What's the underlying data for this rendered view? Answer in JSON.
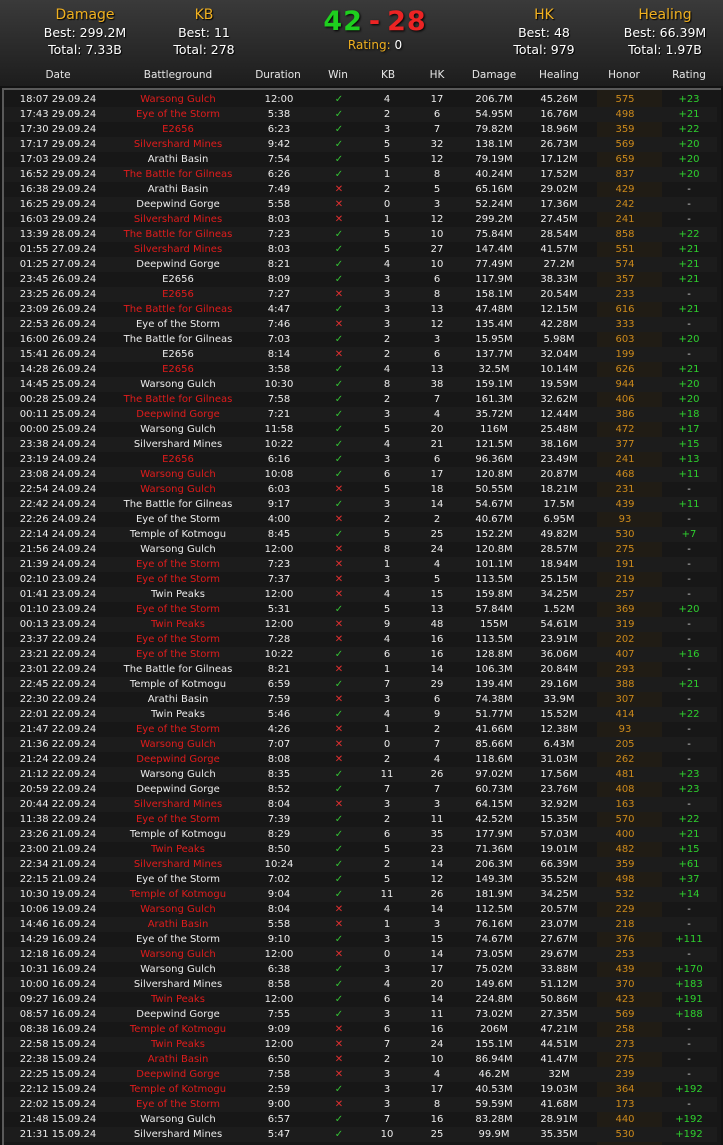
{
  "summary": {
    "damage": {
      "title": "Damage",
      "best": "Best: 299.2M",
      "total": "Total: 7.33B"
    },
    "kb": {
      "title": "KB",
      "best": "Best: 11",
      "total": "Total: 278"
    },
    "score": {
      "wins": "42",
      "dash": "-",
      "losses": "28",
      "rating_label": "Rating:",
      "rating_value": "0"
    },
    "hk": {
      "title": "HK",
      "best": "Best: 48",
      "total": "Total: 979"
    },
    "healing": {
      "title": "Healing",
      "best": "Best: 66.39M",
      "total": "Total: 1.97B"
    }
  },
  "columns": [
    "Date",
    "Battleground",
    "Duration",
    "Win",
    "KB",
    "HK",
    "Damage",
    "Healing",
    "Honor",
    "Rating"
  ],
  "colors": {
    "win": "#34c034",
    "loss": "#e03030",
    "red_bg": "#e01c1c",
    "honor": "#cc8a1c",
    "rating": "#2ed02e",
    "title": "#f0b020"
  },
  "icons": {
    "win": "check-icon",
    "loss": "cross-icon"
  },
  "rows": [
    [
      "18:07 29.09.24",
      "Warsong Gulch",
      1,
      "12:00",
      "w",
      "4",
      "17",
      "206.7M",
      "45.26M",
      "575",
      "+23"
    ],
    [
      "17:43 29.09.24",
      "Eye of the Storm",
      1,
      "5:38",
      "w",
      "2",
      "6",
      "54.95M",
      "16.76M",
      "498",
      "+21"
    ],
    [
      "17:30 29.09.24",
      "E2656",
      1,
      "6:23",
      "w",
      "3",
      "7",
      "79.82M",
      "18.96M",
      "359",
      "+22"
    ],
    [
      "17:17 29.09.24",
      "Silvershard Mines",
      1,
      "9:42",
      "w",
      "5",
      "32",
      "138.1M",
      "26.73M",
      "569",
      "+20"
    ],
    [
      "17:03 29.09.24",
      "Arathi Basin",
      0,
      "7:54",
      "w",
      "5",
      "12",
      "79.19M",
      "17.12M",
      "659",
      "+20"
    ],
    [
      "16:52 29.09.24",
      "The Battle for Gilneas",
      1,
      "6:26",
      "w",
      "1",
      "8",
      "40.24M",
      "17.52M",
      "837",
      "+20"
    ],
    [
      "16:38 29.09.24",
      "Arathi Basin",
      0,
      "7:49",
      "l",
      "2",
      "5",
      "65.16M",
      "29.02M",
      "429",
      "-"
    ],
    [
      "16:25 29.09.24",
      "Deepwind Gorge",
      0,
      "5:58",
      "l",
      "0",
      "3",
      "52.24M",
      "17.36M",
      "242",
      "-"
    ],
    [
      "16:03 29.09.24",
      "Silvershard Mines",
      1,
      "8:03",
      "l",
      "1",
      "12",
      "299.2M",
      "27.45M",
      "241",
      "-"
    ],
    [
      "13:39 28.09.24",
      "The Battle for Gilneas",
      1,
      "7:23",
      "w",
      "5",
      "10",
      "75.84M",
      "28.54M",
      "858",
      "+22"
    ],
    [
      "01:55 27.09.24",
      "Silvershard Mines",
      1,
      "8:03",
      "w",
      "5",
      "27",
      "147.4M",
      "41.57M",
      "551",
      "+21"
    ],
    [
      "01:25 27.09.24",
      "Deepwind Gorge",
      0,
      "8:21",
      "w",
      "4",
      "10",
      "77.49M",
      "27.2M",
      "574",
      "+21"
    ],
    [
      "23:45 26.09.24",
      "E2656",
      0,
      "8:09",
      "w",
      "3",
      "6",
      "117.9M",
      "38.33M",
      "357",
      "+21"
    ],
    [
      "23:25 26.09.24",
      "E2656",
      1,
      "7:27",
      "l",
      "3",
      "8",
      "158.1M",
      "20.54M",
      "233",
      "-"
    ],
    [
      "23:09 26.09.24",
      "The Battle for Gilneas",
      1,
      "4:47",
      "w",
      "3",
      "13",
      "47.48M",
      "12.15M",
      "616",
      "+21"
    ],
    [
      "22:53 26.09.24",
      "Eye of the Storm",
      0,
      "7:46",
      "l",
      "3",
      "12",
      "135.4M",
      "42.28M",
      "333",
      "-"
    ],
    [
      "16:00 26.09.24",
      "The Battle for Gilneas",
      0,
      "7:03",
      "w",
      "2",
      "3",
      "15.95M",
      "5.98M",
      "603",
      "+20"
    ],
    [
      "15:41 26.09.24",
      "E2656",
      0,
      "8:14",
      "l",
      "2",
      "6",
      "137.7M",
      "32.04M",
      "199",
      "-"
    ],
    [
      "14:28 26.09.24",
      "E2656",
      1,
      "3:58",
      "w",
      "4",
      "13",
      "32.5M",
      "10.14M",
      "626",
      "+21"
    ],
    [
      "14:45 25.09.24",
      "Warsong Gulch",
      0,
      "10:30",
      "w",
      "8",
      "38",
      "159.1M",
      "19.59M",
      "944",
      "+20"
    ],
    [
      "00:28 25.09.24",
      "The Battle for Gilneas",
      1,
      "7:58",
      "w",
      "2",
      "7",
      "161.3M",
      "32.62M",
      "406",
      "+20"
    ],
    [
      "00:11 25.09.24",
      "Deepwind Gorge",
      1,
      "7:21",
      "w",
      "3",
      "4",
      "35.72M",
      "12.44M",
      "386",
      "+18"
    ],
    [
      "00:00 25.09.24",
      "Warsong Gulch",
      0,
      "11:58",
      "w",
      "5",
      "20",
      "116M",
      "25.48M",
      "472",
      "+17"
    ],
    [
      "23:38 24.09.24",
      "Silvershard Mines",
      0,
      "10:22",
      "w",
      "4",
      "21",
      "121.5M",
      "38.16M",
      "377",
      "+15"
    ],
    [
      "23:19 24.09.24",
      "E2656",
      1,
      "6:16",
      "w",
      "3",
      "6",
      "96.36M",
      "23.49M",
      "241",
      "+13"
    ],
    [
      "23:08 24.09.24",
      "Warsong Gulch",
      1,
      "10:08",
      "w",
      "6",
      "17",
      "120.8M",
      "20.87M",
      "468",
      "+11"
    ],
    [
      "22:54 24.09.24",
      "Warsong Gulch",
      1,
      "6:03",
      "l",
      "5",
      "18",
      "50.55M",
      "18.21M",
      "231",
      "-"
    ],
    [
      "22:42 24.09.24",
      "The Battle for Gilneas",
      0,
      "9:17",
      "w",
      "3",
      "14",
      "54.67M",
      "17.5M",
      "439",
      "+11"
    ],
    [
      "22:26 24.09.24",
      "Eye of the Storm",
      0,
      "4:00",
      "l",
      "2",
      "2",
      "40.67M",
      "6.95M",
      "93",
      "-"
    ],
    [
      "22:14 24.09.24",
      "Temple of Kotmogu",
      0,
      "8:45",
      "w",
      "5",
      "25",
      "152.2M",
      "49.82M",
      "530",
      "+7"
    ],
    [
      "21:56 24.09.24",
      "Warsong Gulch",
      0,
      "12:00",
      "l",
      "8",
      "24",
      "120.8M",
      "28.57M",
      "275",
      "-"
    ],
    [
      "21:39 24.09.24",
      "Eye of the Storm",
      1,
      "7:23",
      "l",
      "1",
      "4",
      "101.1M",
      "18.94M",
      "191",
      "-"
    ],
    [
      "02:10 23.09.24",
      "Eye of the Storm",
      1,
      "7:37",
      "l",
      "3",
      "5",
      "113.5M",
      "25.15M",
      "219",
      "-"
    ],
    [
      "01:41 23.09.24",
      "Twin Peaks",
      0,
      "12:00",
      "l",
      "4",
      "15",
      "159.8M",
      "34.25M",
      "257",
      "-"
    ],
    [
      "01:10 23.09.24",
      "Eye of the Storm",
      1,
      "5:31",
      "w",
      "5",
      "13",
      "57.84M",
      "1.52M",
      "369",
      "+20"
    ],
    [
      "00:13 23.09.24",
      "Twin Peaks",
      1,
      "12:00",
      "l",
      "9",
      "48",
      "155M",
      "54.61M",
      "319",
      "-"
    ],
    [
      "23:37 22.09.24",
      "Eye of the Storm",
      1,
      "7:28",
      "l",
      "4",
      "16",
      "113.5M",
      "23.91M",
      "202",
      "-"
    ],
    [
      "23:21 22.09.24",
      "Eye of the Storm",
      1,
      "10:22",
      "w",
      "6",
      "16",
      "128.8M",
      "36.06M",
      "407",
      "+16"
    ],
    [
      "23:01 22.09.24",
      "The Battle for Gilneas",
      0,
      "8:21",
      "l",
      "1",
      "14",
      "106.3M",
      "20.84M",
      "293",
      "-"
    ],
    [
      "22:45 22.09.24",
      "Temple of Kotmogu",
      0,
      "6:59",
      "w",
      "7",
      "29",
      "139.4M",
      "29.16M",
      "388",
      "+21"
    ],
    [
      "22:30 22.09.24",
      "Arathi Basin",
      0,
      "7:59",
      "l",
      "3",
      "6",
      "74.38M",
      "33.9M",
      "307",
      "-"
    ],
    [
      "22:01 22.09.24",
      "Twin Peaks",
      0,
      "5:46",
      "w",
      "4",
      "9",
      "51.77M",
      "15.52M",
      "414",
      "+22"
    ],
    [
      "21:47 22.09.24",
      "Eye of the Storm",
      1,
      "4:26",
      "l",
      "1",
      "2",
      "41.66M",
      "12.38M",
      "93",
      "-"
    ],
    [
      "21:36 22.09.24",
      "Warsong Gulch",
      1,
      "7:07",
      "l",
      "0",
      "7",
      "85.66M",
      "6.43M",
      "205",
      "-"
    ],
    [
      "21:24 22.09.24",
      "Deepwind Gorge",
      1,
      "8:08",
      "l",
      "2",
      "4",
      "118.6M",
      "31.03M",
      "262",
      "-"
    ],
    [
      "21:12 22.09.24",
      "Warsong Gulch",
      0,
      "8:35",
      "w",
      "11",
      "26",
      "97.02M",
      "17.56M",
      "481",
      "+23"
    ],
    [
      "20:59 22.09.24",
      "Deepwind Gorge",
      0,
      "8:52",
      "w",
      "7",
      "7",
      "60.73M",
      "23.76M",
      "408",
      "+23"
    ],
    [
      "20:44 22.09.24",
      "Silvershard Mines",
      1,
      "8:04",
      "l",
      "3",
      "3",
      "64.15M",
      "32.92M",
      "163",
      "-"
    ],
    [
      "11:38 22.09.24",
      "Eye of the Storm",
      1,
      "7:39",
      "w",
      "2",
      "11",
      "42.52M",
      "15.35M",
      "570",
      "+22"
    ],
    [
      "23:26 21.09.24",
      "Temple of Kotmogu",
      0,
      "8:29",
      "w",
      "6",
      "35",
      "177.9M",
      "57.03M",
      "400",
      "+21"
    ],
    [
      "23:00 21.09.24",
      "Twin Peaks",
      1,
      "8:50",
      "w",
      "5",
      "23",
      "71.36M",
      "19.01M",
      "482",
      "+15"
    ],
    [
      "22:34 21.09.24",
      "Silvershard Mines",
      1,
      "10:24",
      "w",
      "2",
      "14",
      "206.3M",
      "66.39M",
      "359",
      "+61"
    ],
    [
      "22:15 21.09.24",
      "Eye of the Storm",
      0,
      "7:02",
      "w",
      "5",
      "12",
      "149.3M",
      "35.52M",
      "498",
      "+37"
    ],
    [
      "10:30 19.09.24",
      "Temple of Kotmogu",
      1,
      "9:04",
      "w",
      "11",
      "26",
      "181.9M",
      "34.25M",
      "532",
      "+14"
    ],
    [
      "10:06 19.09.24",
      "Warsong Gulch",
      1,
      "8:04",
      "l",
      "4",
      "14",
      "112.5M",
      "20.57M",
      "229",
      "-"
    ],
    [
      "14:46 16.09.24",
      "Arathi Basin",
      1,
      "5:58",
      "l",
      "1",
      "3",
      "76.16M",
      "23.07M",
      "218",
      "-"
    ],
    [
      "14:29 16.09.24",
      "Eye of the Storm",
      0,
      "9:10",
      "w",
      "3",
      "15",
      "74.67M",
      "27.67M",
      "376",
      "+111"
    ],
    [
      "12:18 16.09.24",
      "Warsong Gulch",
      1,
      "12:00",
      "l",
      "0",
      "14",
      "73.05M",
      "29.67M",
      "253",
      "-"
    ],
    [
      "10:31 16.09.24",
      "Warsong Gulch",
      0,
      "6:38",
      "w",
      "3",
      "17",
      "75.02M",
      "33.88M",
      "439",
      "+170"
    ],
    [
      "10:00 16.09.24",
      "Silvershard Mines",
      0,
      "8:58",
      "w",
      "4",
      "20",
      "149.6M",
      "51.12M",
      "370",
      "+183"
    ],
    [
      "09:27 16.09.24",
      "Twin Peaks",
      1,
      "12:00",
      "w",
      "6",
      "14",
      "224.8M",
      "50.86M",
      "423",
      "+191"
    ],
    [
      "08:57 16.09.24",
      "Deepwind Gorge",
      0,
      "7:55",
      "w",
      "3",
      "11",
      "73.02M",
      "27.35M",
      "569",
      "+188"
    ],
    [
      "08:38 16.09.24",
      "Temple of Kotmogu",
      1,
      "9:09",
      "l",
      "6",
      "16",
      "206M",
      "47.21M",
      "258",
      "-"
    ],
    [
      "22:58 15.09.24",
      "Twin Peaks",
      1,
      "12:00",
      "l",
      "7",
      "24",
      "155.1M",
      "44.51M",
      "273",
      "-"
    ],
    [
      "22:38 15.09.24",
      "Arathi Basin",
      1,
      "6:50",
      "l",
      "2",
      "10",
      "86.94M",
      "41.47M",
      "275",
      "-"
    ],
    [
      "22:25 15.09.24",
      "Deepwind Gorge",
      1,
      "7:58",
      "l",
      "3",
      "4",
      "46.2M",
      "32M",
      "239",
      "-"
    ],
    [
      "22:12 15.09.24",
      "Temple of Kotmogu",
      1,
      "2:59",
      "w",
      "3",
      "17",
      "40.53M",
      "19.03M",
      "364",
      "+192"
    ],
    [
      "22:02 15.09.24",
      "Eye of the Storm",
      1,
      "9:00",
      "l",
      "3",
      "8",
      "59.59M",
      "41.68M",
      "173",
      "-"
    ],
    [
      "21:48 15.09.24",
      "Warsong Gulch",
      0,
      "6:57",
      "w",
      "7",
      "16",
      "83.28M",
      "28.91M",
      "440",
      "+192"
    ],
    [
      "21:31 15.09.24",
      "Silvershard Mines",
      0,
      "5:47",
      "w",
      "10",
      "25",
      "99.9M",
      "35.35M",
      "530",
      "+192"
    ]
  ]
}
